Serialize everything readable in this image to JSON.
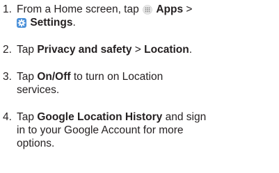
{
  "steps": [
    {
      "number": "1.",
      "line1_prefix": "From a Home screen, tap",
      "apps_icon": "apps-grid-icon",
      "apps_label": "Apps",
      "separator": ">",
      "settings_icon": "settings-gear-icon",
      "settings_label": "Settings",
      "line2_suffix": "."
    },
    {
      "number": "2.",
      "prefix": "Tap",
      "bold1": "Privacy and safety",
      "separator": ">",
      "bold2": "Location",
      "suffix": "."
    },
    {
      "number": "3.",
      "prefix": "Tap",
      "bold": "On/Off",
      "line1_suffix": "to turn on Location",
      "line2": "services."
    },
    {
      "number": "4.",
      "prefix": "Tap",
      "bold": "Google Location History",
      "line1_suffix": "and sign",
      "line2": "in to your Google Account for more",
      "line3": "options."
    }
  ],
  "colors": {
    "text": "#231f20",
    "settings_icon_bg": "#4a90d9"
  }
}
